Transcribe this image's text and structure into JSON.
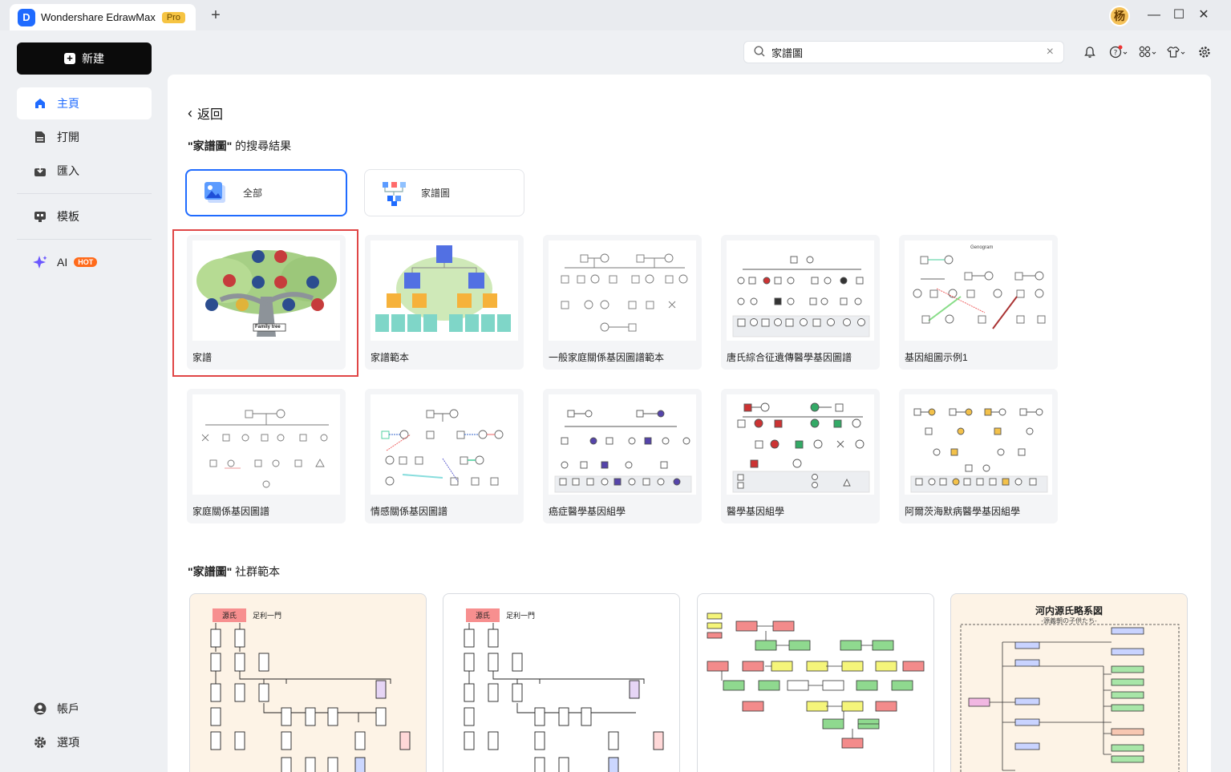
{
  "app": {
    "logo": "D",
    "title": "Wondershare EdrawMax",
    "badge": "Pro",
    "new_tab": "+",
    "avatar": "杨"
  },
  "window": {
    "minimize": "—",
    "maximize": "☐",
    "close": "✕"
  },
  "sidebar": {
    "new_label": "新建",
    "items": [
      {
        "label": "主頁",
        "icon": "home-icon"
      },
      {
        "label": "打開",
        "icon": "file-icon"
      },
      {
        "label": "匯入",
        "icon": "import-icon"
      },
      {
        "label": "模板",
        "icon": "template-icon"
      },
      {
        "label": "AI",
        "icon": "sparkle-icon",
        "badge": "HOT"
      }
    ],
    "bottom": [
      {
        "label": "帳戶",
        "icon": "account-icon"
      },
      {
        "label": "選項",
        "icon": "gear-icon"
      }
    ]
  },
  "search": {
    "value": "家譜圖"
  },
  "main": {
    "back": "返回",
    "results_prefix": "\"家譜圖\"",
    "results_suffix": " 的搜尋結果",
    "filters": [
      {
        "label": "全部"
      },
      {
        "label": "家譜圖"
      }
    ],
    "templates": [
      {
        "label": "家譜",
        "thumb_text": "Family tree"
      },
      {
        "label": "家譜範本"
      },
      {
        "label": "一般家庭關係基因圖譜範本"
      },
      {
        "label": "唐氏綜合征遺傳醫學基因圖譜"
      },
      {
        "label": "基因組圖示例1",
        "thumb_text": "Genogram"
      },
      {
        "label": "家庭關係基因圖譜"
      },
      {
        "label": "情感關係基因圖譜"
      },
      {
        "label": "癌症醫學基因組學"
      },
      {
        "label": "醫學基因組學"
      },
      {
        "label": "阿爾茨海默病醫學基因組學"
      }
    ],
    "community_prefix": "\"家譜圖\"",
    "community_suffix": " 社群範本",
    "community": [
      {
        "tag1": "源氏",
        "tag2": "足利一門"
      },
      {
        "tag1": "源氏",
        "tag2": "足利一門"
      },
      {
        "tag1": ""
      },
      {
        "title": "河内源氏略系図",
        "subtitle": "-源義朝の子供たち-"
      }
    ]
  },
  "colors": {
    "accent": "#1f6bff",
    "highlight": "#e04646",
    "hot": "#ff6a1a"
  }
}
